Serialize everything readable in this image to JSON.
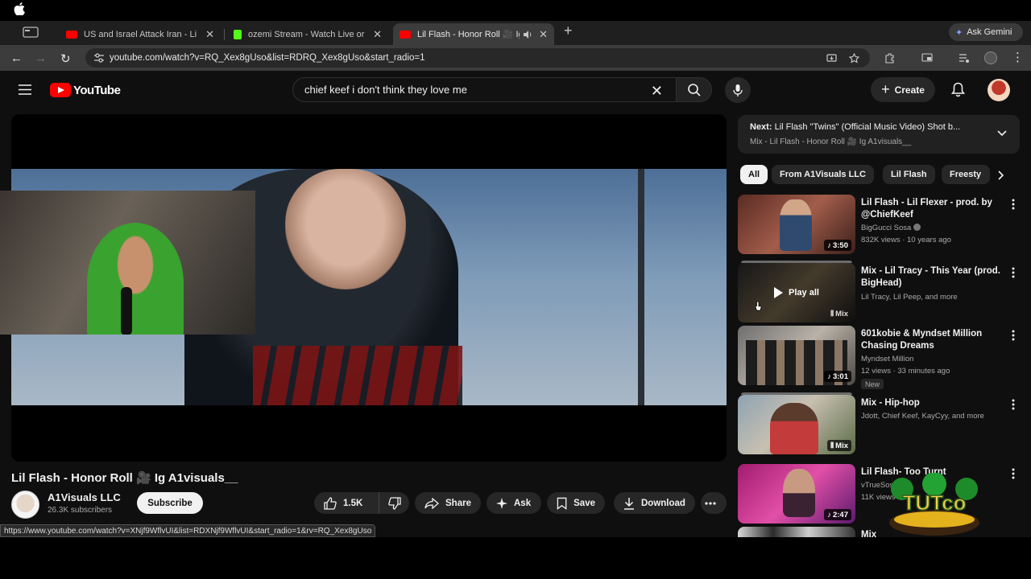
{
  "browser": {
    "tabs": [
      {
        "title": "US and Israel Attack Iran - Li",
        "active": false
      },
      {
        "title": "ozemi Stream - Watch Live or",
        "active": false
      },
      {
        "title": "Lil Flash - Honor Roll 🎥 Ig",
        "active": true
      }
    ],
    "gemini_label": "Ask Gemini",
    "url": "youtube.com/watch?v=RQ_Xex8gUso&list=RDRQ_Xex8gUso&start_radio=1",
    "status_url": "https://www.youtube.com/watch?v=XNjf9WflvUI&list=RDXNjf9WflvUI&start_radio=1&rv=RQ_Xex8gUso"
  },
  "header": {
    "logo_text": "YouTube",
    "search_value": "chief keef i don't think they love me",
    "create_label": "Create"
  },
  "video": {
    "title": "Lil Flash - Honor Roll 🎥 Ig A1visuals__",
    "channel": "A1Visuals LLC",
    "subscribers": "26.3K subscribers",
    "subscribe_label": "Subscribe",
    "likes": "1.5K",
    "share_label": "Share",
    "ask_label": "Ask",
    "save_label": "Save",
    "download_label": "Download"
  },
  "upnext": {
    "prefix": "Next:",
    "title": "Lil Flash \"Twins\" (Official Music Video) Shot b...",
    "playlist": "Mix - Lil Flash - Honor Roll 🎥 Ig A1visuals__"
  },
  "chips": [
    "All",
    "From A1Visuals LLC",
    "Lil Flash",
    "Freesty"
  ],
  "recommendations": [
    {
      "title": "Lil Flash - Lil Flexer - prod. by @ChiefKeef",
      "meta1": "BigGucci Sosa",
      "meta2": "832K views · 10 years ago",
      "duration": "3:50"
    },
    {
      "title": "Mix - Lil Tracy - This Year (prod. BigHead)",
      "meta1": "Lil Tracy, Lil Peep, and more",
      "duration": "Mix",
      "hover": "Play all"
    },
    {
      "title": "601kobie & Myndset Million Chasing Dreams",
      "meta1": "Myndset Million",
      "meta2": "12 views · 33 minutes ago",
      "duration": "3:01",
      "badge": "New"
    },
    {
      "title": "Mix - Hip-hop",
      "meta1": "Jdott, Chief Keef, KayCyy, and more",
      "duration": "Mix"
    },
    {
      "title": "Lil Flash- Too Turnt",
      "meta1": "vTrueSossa",
      "meta2": "11K views",
      "duration": "2:47"
    },
    {
      "title": "Mix",
      "meta1": "",
      "duration": ""
    }
  ],
  "colors": {
    "youtube_red": "#ff0000",
    "page_bg": "#0f0f0f",
    "chip_bg": "#272727"
  },
  "watermark_text": "TUTco"
}
